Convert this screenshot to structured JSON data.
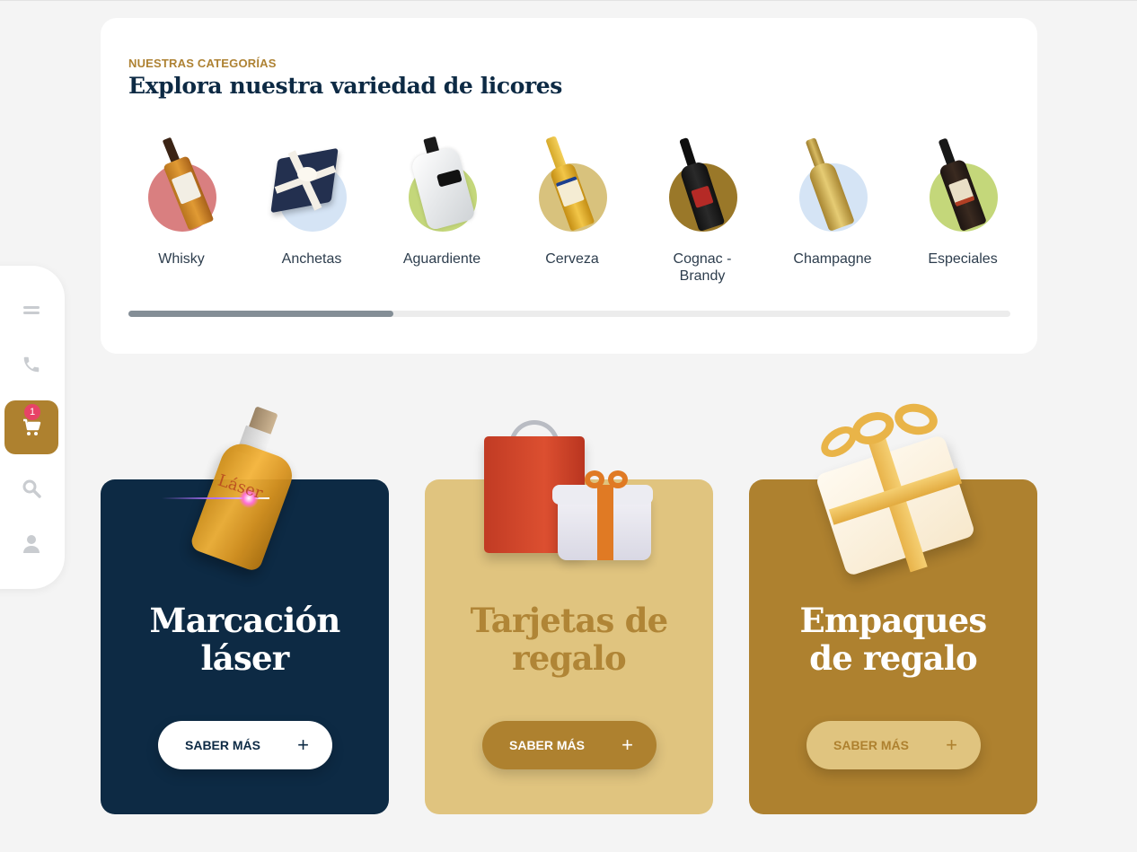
{
  "categories": {
    "eyebrow": "NUESTRAS CATEGORÍAS",
    "title": "Explora nuestra variedad de licores",
    "items": [
      {
        "label": "Whisky",
        "circle": "#d97f80"
      },
      {
        "label": "Anchetas",
        "circle": "#d5e4f5"
      },
      {
        "label": "Aguardiente",
        "circle": "#c4d77a"
      },
      {
        "label": "Cerveza",
        "circle": "#d8c27d"
      },
      {
        "label": "Cognac -\nBrandy",
        "circle": "#9a7829"
      },
      {
        "label": "Champagne",
        "circle": "#d5e4f5"
      },
      {
        "label": "Especiales",
        "circle": "#c4d77a"
      }
    ],
    "scroll_progress": 0.3
  },
  "sidebar": {
    "items": [
      {
        "icon": "menu-icon"
      },
      {
        "icon": "phone-icon"
      },
      {
        "icon": "cart-icon",
        "badge": "1"
      },
      {
        "icon": "search-icon"
      },
      {
        "icon": "user-icon"
      }
    ]
  },
  "services": [
    {
      "title": "Marcación\nláser",
      "button": "SABER MÁS",
      "bg": "#0d2a44",
      "title_color": "#ffffff",
      "btn_bg": "#ffffff",
      "btn_color": "#0d2a44"
    },
    {
      "title": "Tarjetas de\nregalo",
      "button": "SABER MÁS",
      "bg": "#e0c47f",
      "title_color": "#b08536",
      "btn_bg": "#ae812f",
      "btn_color": "#ffffff"
    },
    {
      "title": "Empaques\nde regalo",
      "button": "SABER MÁS",
      "bg": "#ae812f",
      "title_color": "#ffffff",
      "btn_bg": "#e0c47f",
      "btn_color": "#ae812f"
    }
  ],
  "art": {
    "laser_text": "Láser"
  }
}
